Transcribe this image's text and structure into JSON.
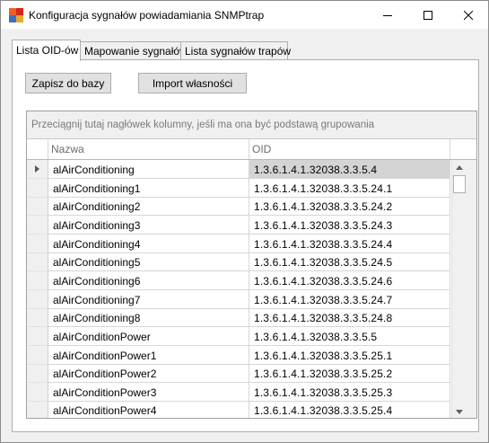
{
  "window": {
    "title": "Konfiguracja sygnałów powiadamiania SNMPtrap",
    "icon": "app-icon",
    "colors": {
      "icon_orange": "#e8602a",
      "icon_red": "#d4261c",
      "icon_blue": "#3b6fc4",
      "icon_gold": "#e8a92a"
    }
  },
  "tabs": [
    {
      "label": "Lista OID-ów"
    },
    {
      "label": "Mapowanie sygnałów"
    },
    {
      "label": "Lista sygnałów trapów"
    }
  ],
  "toolbar": {
    "save_label": "Zapisz do bazy",
    "import_label": "Import własności"
  },
  "grid": {
    "group_hint": "Przeciągnij tutaj nagłówek kolumny, jeśli ma ona być podstawą grupowania",
    "columns": [
      "Nazwa",
      "OID"
    ],
    "selected_row_marker": "row-pointer-icon",
    "rows": [
      {
        "name": "alAirConditioning",
        "oid": "1.3.6.1.4.1.32038.3.3.5.4"
      },
      {
        "name": "alAirConditioning1",
        "oid": "1.3.6.1.4.1.32038.3.3.5.24.1"
      },
      {
        "name": "alAirConditioning2",
        "oid": "1.3.6.1.4.1.32038.3.3.5.24.2"
      },
      {
        "name": "alAirConditioning3",
        "oid": "1.3.6.1.4.1.32038.3.3.5.24.3"
      },
      {
        "name": "alAirConditioning4",
        "oid": "1.3.6.1.4.1.32038.3.3.5.24.4"
      },
      {
        "name": "alAirConditioning5",
        "oid": "1.3.6.1.4.1.32038.3.3.5.24.5"
      },
      {
        "name": "alAirConditioning6",
        "oid": "1.3.6.1.4.1.32038.3.3.5.24.6"
      },
      {
        "name": "alAirConditioning7",
        "oid": "1.3.6.1.4.1.32038.3.3.5.24.7"
      },
      {
        "name": "alAirConditioning8",
        "oid": "1.3.6.1.4.1.32038.3.3.5.24.8"
      },
      {
        "name": "alAirConditionPower",
        "oid": "1.3.6.1.4.1.32038.3.3.5.5"
      },
      {
        "name": "alAirConditionPower1",
        "oid": "1.3.6.1.4.1.32038.3.3.5.25.1"
      },
      {
        "name": "alAirConditionPower2",
        "oid": "1.3.6.1.4.1.32038.3.3.5.25.2"
      },
      {
        "name": "alAirConditionPower3",
        "oid": "1.3.6.1.4.1.32038.3.3.5.25.3"
      },
      {
        "name": "alAirConditionPower4",
        "oid": "1.3.6.1.4.1.32038.3.3.5.25.4"
      }
    ]
  }
}
